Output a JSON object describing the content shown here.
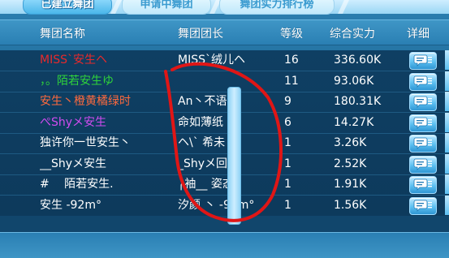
{
  "tabs": [
    {
      "label": "已建立舞团"
    },
    {
      "label": "申请中舞团"
    },
    {
      "label": "舞团实力排行榜"
    }
  ],
  "columns": {
    "name": "舞团名称",
    "leader": "舞团团长",
    "level": "等级",
    "power": "综合实力",
    "detail": "详细"
  },
  "rows": [
    {
      "name": "MISS`安生ヘ",
      "name_color": "#e8292b",
      "leader": "MISS`绒儿ヘ",
      "level": "16",
      "power": "336.60K"
    },
    {
      "name": "，。陌若安生ゆ",
      "name_color": "#2fd33a",
      "leader": "",
      "level": "11",
      "power": "93.06K"
    },
    {
      "name": "安生丶橙黄橘绿时",
      "name_color": "#ff6a3d",
      "leader": "An丶不语",
      "level": "9",
      "power": "180.31K"
    },
    {
      "name": "ぺShyメ安生",
      "name_color": "#d04cf0",
      "leader": "命如薄纸",
      "level": "6",
      "power": "14.27K"
    },
    {
      "name": "独许你一世安生丶",
      "name_color": "#ffffff",
      "leader": "ヘ\\` 希未",
      "level": "1",
      "power": "3.26K"
    },
    {
      "name": "__Shyメ安生",
      "name_color": "#ffffff",
      "leader": "_Shyメ回收",
      "level": "1",
      "power": "2.52K"
    },
    {
      "name": "#　 陌若安生.",
      "name_color": "#ffffff",
      "leader": "╭袖__  姿态",
      "level": "1",
      "power": "1.91K"
    },
    {
      "name": "安生 -92m°",
      "name_color": "#ffffff",
      "leader": "汐颜 丶 -92m°",
      "level": "1",
      "power": "1.56K"
    }
  ],
  "icons": {
    "detail": "chat-bubble-list-icon"
  },
  "colors": {
    "annotation": "#e01616",
    "header_bg": "#3f96c6",
    "table_bg": "#0f3f63"
  }
}
